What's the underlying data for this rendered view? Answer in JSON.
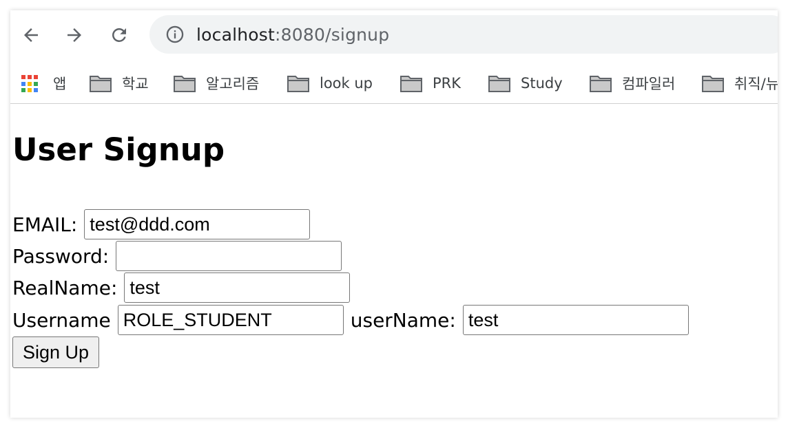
{
  "browser": {
    "url_host": "localhost",
    "url_path": ":8080/signup"
  },
  "bookmarks": [
    {
      "label": "앱"
    },
    {
      "label": "학교"
    },
    {
      "label": "알고리즘"
    },
    {
      "label": "look up"
    },
    {
      "label": "PRK"
    },
    {
      "label": "Study"
    },
    {
      "label": "컴파일러"
    },
    {
      "label": "취직/뉴"
    }
  ],
  "page": {
    "title": "User Signup",
    "email_label": "EMAIL:",
    "email_value": "test@ddd.com",
    "password_label": "Password:",
    "password_value": "",
    "realname_label": "RealName:",
    "realname_value": "test",
    "username_label": "Username",
    "username_value": "ROLE_STUDENT",
    "username2_label": "userName:",
    "username2_value": "test",
    "submit_label": "Sign Up"
  },
  "colors": {
    "omnibox_bg": "#f1f3f4",
    "icon_gray": "#5f6368"
  }
}
